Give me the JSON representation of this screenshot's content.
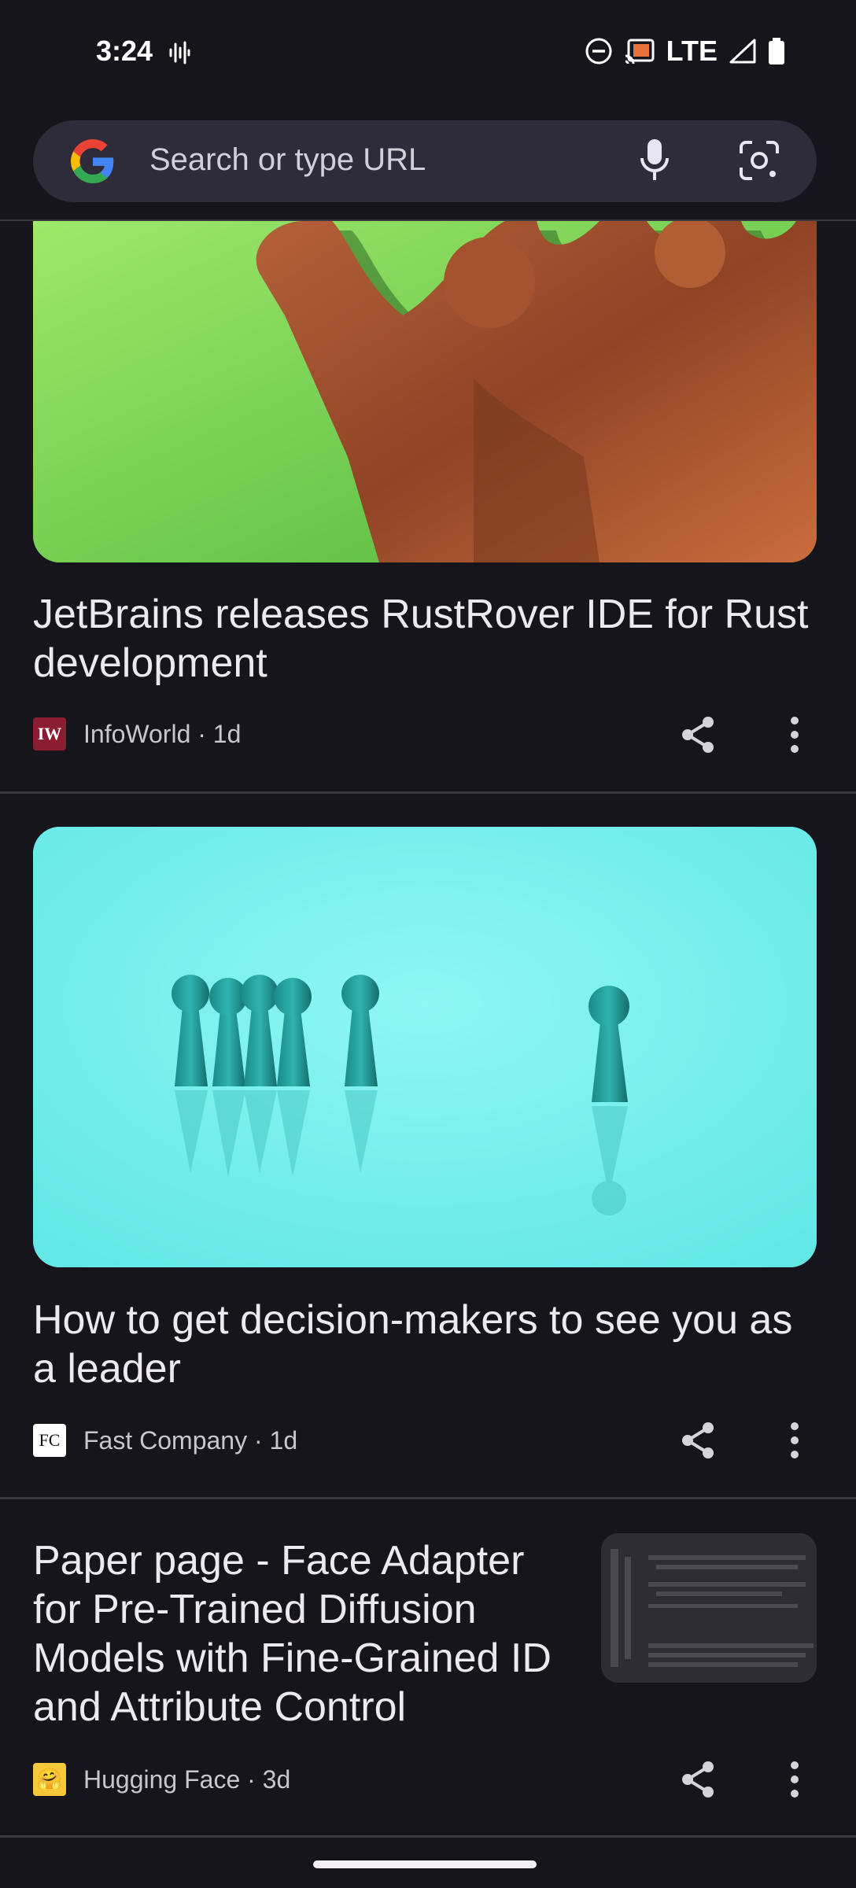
{
  "status_bar": {
    "time": "3:24",
    "network": "LTE"
  },
  "search": {
    "placeholder": "Search or type URL"
  },
  "articles": [
    {
      "title": "JetBrains releases RustRover IDE for Rust development",
      "favicon_text": "IW",
      "source": "InfoWorld · 1d"
    },
    {
      "title": "How to get decision-makers to see you as a leader",
      "favicon_text": "FC",
      "source": "Fast Company · 1d"
    },
    {
      "title": "Paper page - Face Adapter for Pre-Trained Diffusion Models with Fine-Grained ID and Attribute Control",
      "favicon_text": "🤗",
      "source": "Hugging Face · 3d"
    }
  ],
  "colors": {
    "background": "#16151b",
    "searchbar": "#2e2c38",
    "infoworld": "#8b1d33"
  },
  "icons": [
    "google-logo-icon",
    "mic-icon",
    "lens-icon",
    "share-icon",
    "more-vert-icon",
    "cast-icon",
    "battery-icon",
    "signal-icon",
    "dnd-icon"
  ]
}
